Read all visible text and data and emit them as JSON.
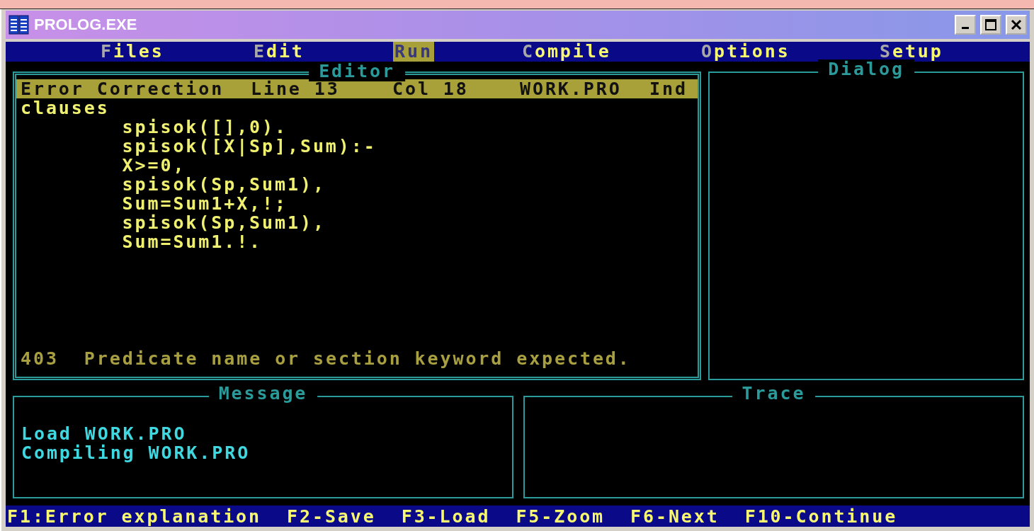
{
  "window": {
    "title": "PROLOG.EXE"
  },
  "menu": [
    {
      "label": "Files",
      "selected": false
    },
    {
      "label": "Edit",
      "selected": false
    },
    {
      "label": "Run",
      "selected": true
    },
    {
      "label": "Compile",
      "selected": false
    },
    {
      "label": "Options",
      "selected": false
    },
    {
      "label": "Setup",
      "selected": false
    }
  ],
  "editor": {
    "title": "Editor",
    "status": [
      "Error Correction",
      "Line 13",
      "Col 18",
      "WORK.PRO",
      "Ind"
    ],
    "lines": [
      "clauses",
      "        spisok([],0).",
      "        spisok([X|Sp],Sum):-",
      "        X>=0,",
      "        spisok(Sp,Sum1),",
      "        Sum=Sum1+X,!;",
      "        spisok(Sp,Sum1),",
      "        Sum=Sum1.!."
    ],
    "error": {
      "code": "403",
      "message": "Predicate name or section keyword expected."
    }
  },
  "dialog": {
    "title": "Dialog"
  },
  "message": {
    "title": "Message",
    "lines": [
      "Load WORK.PRO",
      "Compiling WORK.PRO"
    ]
  },
  "trace": {
    "title": "Trace"
  },
  "status_bar": [
    "F1:Error explanation",
    "F2-Save",
    "F3-Load",
    "F5-Zoom",
    "F6-Next",
    "F10-Continue"
  ]
}
